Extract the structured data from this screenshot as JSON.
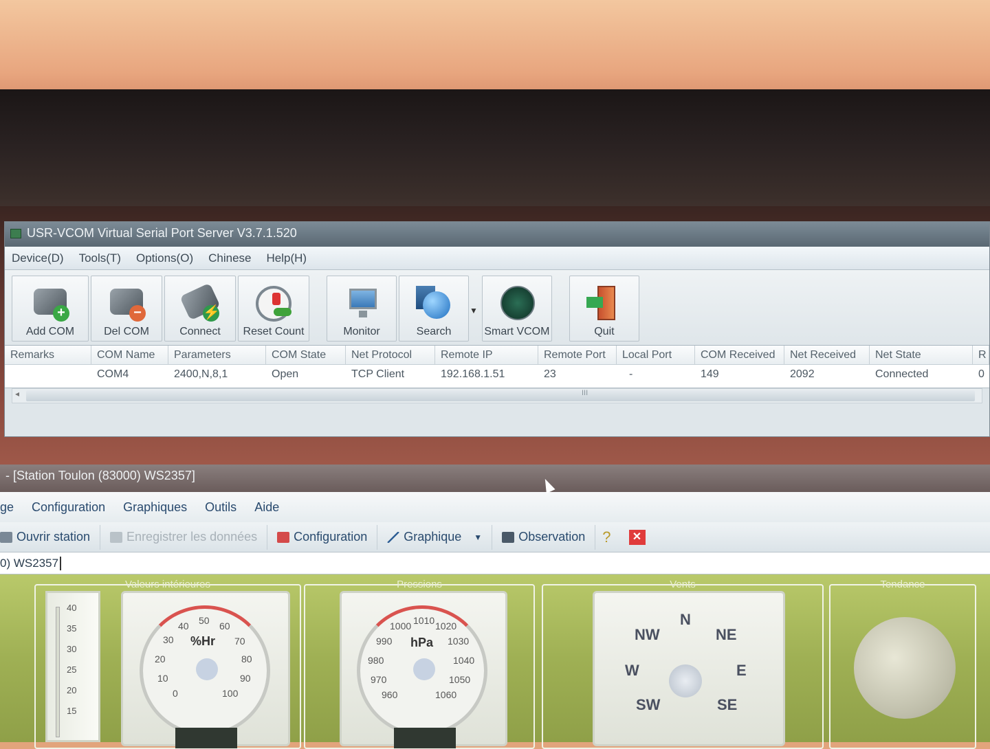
{
  "vcom": {
    "title": "USR-VCOM Virtual Serial Port Server V3.7.1.520",
    "menu": [
      "Device(D)",
      "Tools(T)",
      "Options(O)",
      "Chinese",
      "Help(H)"
    ],
    "toolbar": {
      "add_com": "Add COM",
      "del_com": "Del COM",
      "connect": "Connect",
      "reset_count": "Reset Count",
      "monitor": "Monitor",
      "search": "Search",
      "smart_vcom": "Smart VCOM",
      "quit": "Quit"
    },
    "columns": [
      "Remarks",
      "COM Name",
      "Parameters",
      "COM State",
      "Net Protocol",
      "Remote IP",
      "Remote Port",
      "Local Port",
      "COM Received",
      "Net Received",
      "Net State",
      "R"
    ],
    "rows": [
      {
        "remarks": "",
        "com_name": "COM4",
        "parameters": "2400,N,8,1",
        "com_state": "Open",
        "net_protocol": "TCP Client",
        "remote_ip": "192.168.1.51",
        "remote_port": "23",
        "local_port": "-",
        "com_received": "149",
        "net_received": "2092",
        "net_state": "Connected",
        "r": "0"
      }
    ],
    "scroll_grip": "III"
  },
  "weather": {
    "title": "- [Station Toulon (83000) WS2357]",
    "menu": [
      "ge",
      "Configuration",
      "Graphiques",
      "Outils",
      "Aide"
    ],
    "toolbar": {
      "open_station": "Ouvrir station",
      "save_data": "Enregistrer les données",
      "configuration": "Configuration",
      "graph": "Graphique",
      "observation": "Observation",
      "help": "?",
      "close": "✕"
    },
    "station_combo": "0) WS2357",
    "panels": {
      "interior": "Valeurs intérieures",
      "pressure": "Pressions",
      "wind": "Vents",
      "trend": "Tendance"
    },
    "thermometer_scale": [
      "40",
      "35",
      "30",
      "25",
      "20",
      "15"
    ],
    "humidity": {
      "unit": "%Hr",
      "labels": [
        "40",
        "50",
        "60",
        "30",
        "70",
        "20",
        "80",
        "10",
        "90",
        "0",
        "100"
      ]
    },
    "pressure_gauge": {
      "unit": "hPa",
      "labels": [
        "1000",
        "1010",
        "1020",
        "990",
        "1030",
        "980",
        "1040",
        "970",
        "1050",
        "960",
        "1060"
      ]
    },
    "compass": {
      "n": "N",
      "ne": "NE",
      "nw": "NW",
      "e": "E",
      "w": "W",
      "se": "SE",
      "sw": "SW"
    }
  },
  "colors": {
    "accent_red": "#d9534f",
    "dashboard_green": "#9fb054"
  }
}
